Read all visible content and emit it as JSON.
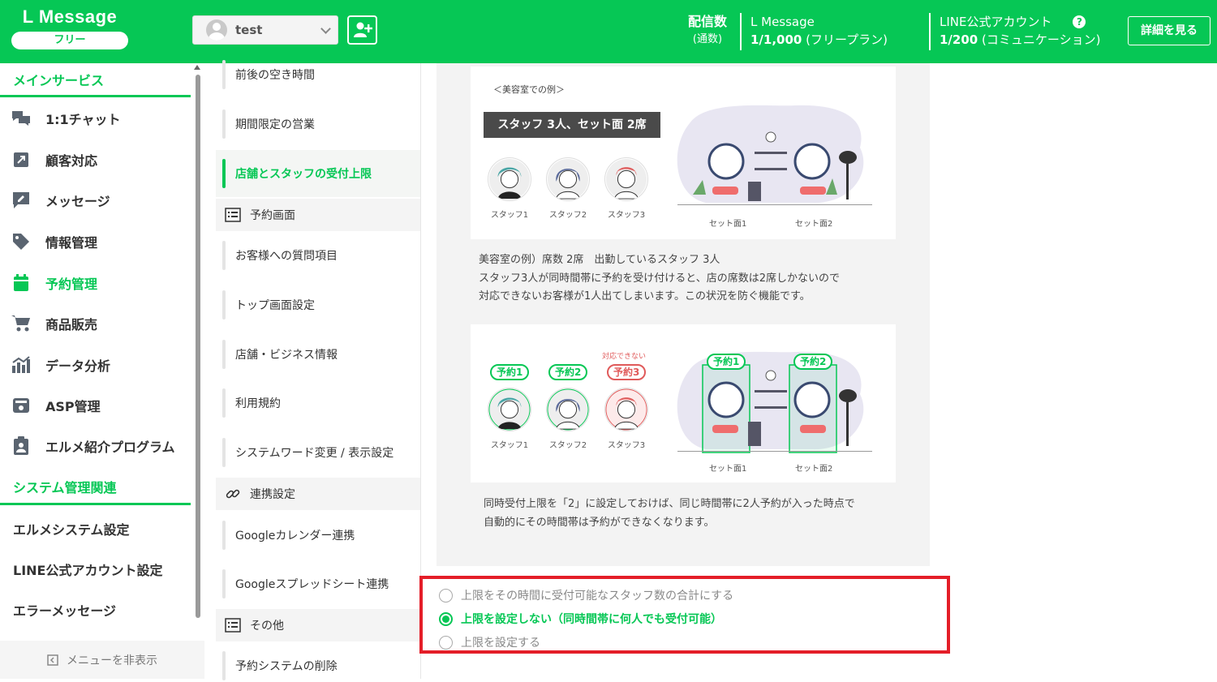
{
  "header": {
    "logo": "L Message",
    "plan": "フリー",
    "account_name": "test",
    "delivery_label": "配信数",
    "delivery_sub": "(通数)",
    "lmessage_label": "L Message",
    "lmessage_value": "1/1,000",
    "lmessage_plan": "(フリープラン)",
    "line_label": "LINE公式アカウント",
    "line_value": "1/200",
    "line_plan": "(コミュニケーション)",
    "details_button": "詳細を見る",
    "help_icon": "?"
  },
  "sidebar": {
    "main_heading": "メインサービス",
    "items": [
      {
        "label": "1:1チャット",
        "icon": "chat-icon"
      },
      {
        "label": "顧客対応",
        "icon": "customer-icon"
      },
      {
        "label": "メッセージ",
        "icon": "message-icon"
      },
      {
        "label": "情報管理",
        "icon": "tag-icon"
      },
      {
        "label": "予約管理",
        "icon": "calendar-icon",
        "active": true
      },
      {
        "label": "商品販売",
        "icon": "cart-icon"
      },
      {
        "label": "データ分析",
        "icon": "chart-icon"
      },
      {
        "label": "ASP管理",
        "icon": "asp-icon"
      },
      {
        "label": "エルメ紹介プログラム",
        "icon": "referral-icon"
      }
    ],
    "system_heading": "システム管理関連",
    "system_items": [
      "エルメシステム設定",
      "LINE公式アカウント設定",
      "エラーメッセージ"
    ],
    "hide_menu": "メニューを非表示"
  },
  "submenu": {
    "items": [
      "前後の空き時間",
      "期間限定の営業",
      "店舗とスタッフの受付上限",
      "予約画面",
      "お客様への質問項目",
      "トップ画面設定",
      "店舗・ビジネス情報",
      "利用規約",
      "システムワード変更 / 表示設定",
      "連携設定",
      "Googleカレンダー連携",
      "Googleスプレッドシート連携",
      "その他",
      "予約システムの削除"
    ]
  },
  "example": {
    "caption": "＜美容室での例＞",
    "title": "スタッフ 3人、セット面 2席",
    "staff": [
      "スタッフ1",
      "スタッフ2",
      "スタッフ3"
    ],
    "sets": [
      "セット面1",
      "セット面2"
    ],
    "description": "美容室の例）席数 2席　出勤しているスタッフ 3人\nスタッフ3人が同時間帯に予約を受け付けると、店の席数は2席しかないので\n対応できないお客様が1人出てしまいます。この状況を防ぐ機能です。",
    "reservations": [
      "予約1",
      "予約2",
      "予約3"
    ],
    "cannot_label": "対応できない",
    "description2": "同時受付上限を「2」に設定しておけば、同じ時間帯に2人予約が入った時点で\n自動的にその時間帯は予約ができなくなります。"
  },
  "options": [
    {
      "label": "上限をその時間に受付可能なスタッフ数の合計にする",
      "selected": false
    },
    {
      "label": "上限を設定しない（同時間帯に何人でも受付可能）",
      "selected": true
    },
    {
      "label": "上限を設定する",
      "selected": false
    }
  ],
  "colors": {
    "brand": "#06c755",
    "highlight": "#e41e28",
    "alert": "#e05a5a"
  }
}
